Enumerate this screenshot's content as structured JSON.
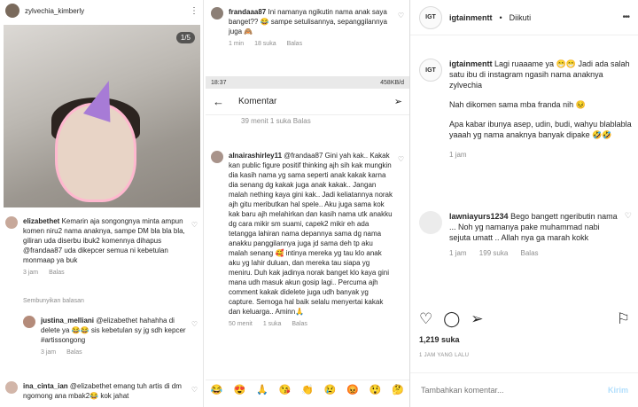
{
  "panel_a": {
    "username": "zylvechia_kimberly",
    "photo_counter": "1/5",
    "comment1": {
      "user": "elizabethet",
      "text": "Kemarin aja songongnya minta ampun komen niru2 nama anaknya, sampe DM bla bla bla, giliran uda diserbu ibuk2 komennya dihapus @frandaa87 uda dikepcer semua ni kebetulan monmaap ya buk",
      "time": "3 jam",
      "reply": "Balas"
    },
    "hide_replies": "Sembunyikan balasan",
    "comment2": {
      "user": "justina_melliani",
      "mention": "@elizabethet",
      "text": "hahahha di delete ya 😂😂 sis kebetulan sy jg sdh kepcer #artissongong",
      "time": "3 jam",
      "reply": "Balas"
    },
    "comment3": {
      "user": "ina_cinta_ian",
      "mention": "@elizabethet",
      "text": "emang tuh artis di dm ngomong ana mbak2😂 kok jahat"
    }
  },
  "panel_b": {
    "top_comment": {
      "user": "frandaaa87",
      "text": "Ini namanya ngikutin nama anak saya banget?? 😂 sampe setulisannya, sepanggilannya juga 🙈",
      "time": "1 min",
      "likes": "18 suka",
      "reply": "Balas"
    },
    "status_time": "18:37",
    "status_right": "458KB/d",
    "komentar_title": "Komentar",
    "under_meta": "39 menit   1 suka   Balas",
    "long_comment": {
      "user": "alnairashirley11",
      "mention": "@frandaa87",
      "text": "Gini yah kak.. Kakak kan public figure positif thinking ajh sih kak mungkin dia kasih nama yg sama seperti anak kakak karna dia senang dg kakak juga anak kakak.. Jangan malah nething kaya gini kak.. Jadi keliatannya norak ajh gitu meributkan hal spele.. Aku juga sama kok kak baru ajh melahirkan dan kasih nama utk anakku dg cara mikir sm suami, capek2 mikir eh ada tetangga lahiran nama depannya sama dg nama anakku panggilannya juga jd sama deh tp aku malah senang 🥰 intinya mereka yg tau klo anak aku yg lahir duluan, dan mereka tau siapa yg meniru. Duh kak jadinya norak banget klo kaya gini mana udh masuk akun gosip lagi.. Percuma ajh comment kakak didelete juga udh banyak yg capture. Semoga hal baik selalu menyertai kakak dan keluarga.. Aminn🙏",
      "time": "50 menit",
      "likes": "1 suka",
      "reply": "Balas"
    },
    "emojis": [
      "😂",
      "😍",
      "🙏",
      "😘",
      "👏",
      "😢",
      "😡",
      "😲",
      "🤔"
    ]
  },
  "ig": {
    "username": "igtainmentt",
    "follow_status": "Diikuti",
    "avatar_text": "IGT",
    "caption": {
      "user": "igtainmentt",
      "line1": "Lagi ruaaame ya 😁😁 Jadi ada salah satu ibu di instagram ngasih nama anaknya zylvechia",
      "line2": "Nah dikomen sama mba franda nih 😣",
      "line3": "Apa kabar ibunya asep, udin, budi, wahyu blablabla yaaah yg nama anaknya banyak dipake 🤣🤣",
      "time": "1 jam"
    },
    "comment": {
      "user": "lawniayurs1234",
      "text": "Bego bangett ngeributin nama ... Noh yg namanya pake muhammad nabi sejuta umatt .. Allah nya ga marah kokk",
      "time": "1 jam",
      "likes": "199 suka",
      "reply": "Balas"
    },
    "likes": "1,219 suka",
    "post_time": "1 JAM YANG LALU",
    "add_comment_placeholder": "Tambahkan komentar...",
    "send_label": "Kirim"
  }
}
